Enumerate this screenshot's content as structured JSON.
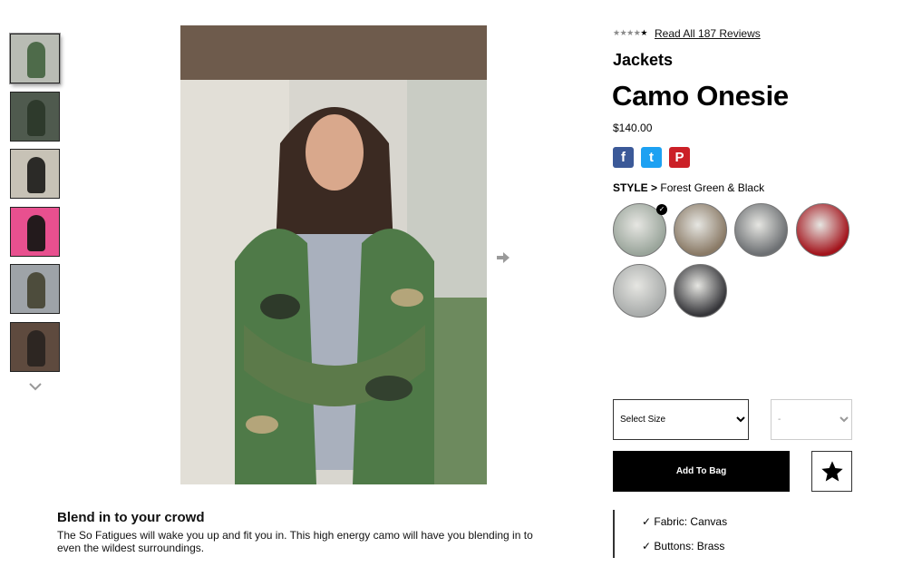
{
  "thumbnails": [
    {
      "name": "thumb-1",
      "bg": "#b9bcb4",
      "fig": "#4e6b4a"
    },
    {
      "name": "thumb-2",
      "bg": "#4f5a4e",
      "fig": "#2e3a2c"
    },
    {
      "name": "thumb-3",
      "bg": "#c7c2b6",
      "fig": "#2b2a27"
    },
    {
      "name": "thumb-4",
      "bg": "#e8508f",
      "fig": "#231a1c"
    },
    {
      "name": "thumb-5",
      "bg": "#9ea3a8",
      "fig": "#4d4c3c"
    },
    {
      "name": "thumb-6",
      "bg": "#5e4a3e",
      "fig": "#2d2622"
    }
  ],
  "rating": {
    "value": 4,
    "max": 5,
    "reviews_label": "Read All 187 Reviews"
  },
  "category": "Jackets",
  "product_title": "Camo Onesie",
  "price": "$140.00",
  "social": {
    "facebook": "f",
    "twitter": "t",
    "pinterest": "P"
  },
  "style": {
    "label": "STYLE >",
    "value": "Forest Green & Black"
  },
  "swatches": [
    {
      "color": "#9aa59b",
      "selected": true
    },
    {
      "color": "#8a7a66",
      "selected": false
    },
    {
      "color": "#6d7073",
      "selected": false
    },
    {
      "color": "#a3141c",
      "selected": false
    },
    {
      "color": "#a9acab",
      "selected": false
    },
    {
      "color": "#36363a",
      "selected": false
    }
  ],
  "size_select": {
    "label": "Select Size"
  },
  "qty_select": {
    "label": "-"
  },
  "add_to_bag": "Add To Bag",
  "description": {
    "title": "Blend in to your crowd",
    "body": "The So Fatigues will wake you up and fit you in. This high energy camo will have you blending in to even the wildest surroundings."
  },
  "features": [
    "✓ Fabric: Canvas",
    "✓ Buttons: Brass"
  ],
  "colors": {
    "accent": "#000000",
    "facebook": "#3b5998",
    "twitter": "#1da1f2",
    "pinterest": "#cb2027"
  }
}
